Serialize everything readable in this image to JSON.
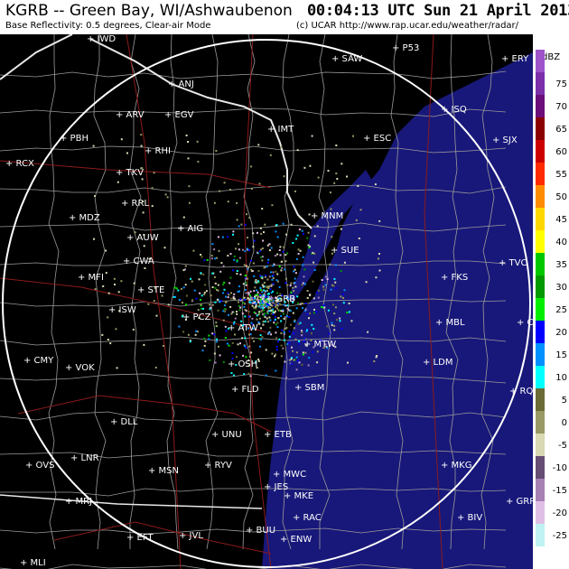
{
  "header": {
    "station": "KGRB -- Green Bay, WI/Ashwaubenon",
    "datetime": "00:04:13 UTC Sun 21 April 2013",
    "product": "Base Reflectivity: 0.5 degrees, Clear-air Mode",
    "credit": "(c) UCAR  http://www.rap.ucar.edu/weather/radar/"
  },
  "legend": {
    "title": "dBZ",
    "levels": [
      {
        "label": "75",
        "color": "#9e53c9"
      },
      {
        "label": "70",
        "color": "#7b2fa8"
      },
      {
        "label": "65",
        "color": "#6b0e7a"
      },
      {
        "label": "60",
        "color": "#8b0000"
      },
      {
        "label": "55",
        "color": "#cd0000"
      },
      {
        "label": "50",
        "color": "#ff2a00"
      },
      {
        "label": "45",
        "color": "#ff8c00"
      },
      {
        "label": "40",
        "color": "#ffd700"
      },
      {
        "label": "35",
        "color": "#ffff00"
      },
      {
        "label": "30",
        "color": "#00c800"
      },
      {
        "label": "25",
        "color": "#009900"
      },
      {
        "label": "20",
        "color": "#00ee00"
      },
      {
        "label": "15",
        "color": "#0000ff"
      },
      {
        "label": "10",
        "color": "#0090ff"
      },
      {
        "label": "5",
        "color": "#00ffff"
      },
      {
        "label": "0",
        "color": "#6b6b36"
      },
      {
        "label": "-5",
        "color": "#999966"
      },
      {
        "label": "-10",
        "color": "#d9d9b3"
      },
      {
        "label": "-15",
        "color": "#664d73"
      },
      {
        "label": "-20",
        "color": "#a680b3"
      },
      {
        "label": "-25",
        "color": "#e0bfe6"
      },
      {
        "label": "",
        "color": "#bff2f2"
      }
    ]
  },
  "map": {
    "lake_color": "#18187a",
    "county_color": "#9a9a9a",
    "state_color": "#e8e8e8",
    "highway_color": "#8b1a1a",
    "range_ring_color": "#ffffff"
  },
  "cities": [
    {
      "name": "IWD"
    },
    {
      "name": "SAW"
    },
    {
      "name": "P53"
    },
    {
      "name": "ERY"
    },
    {
      "name": "ANJ"
    },
    {
      "name": "ISQ"
    },
    {
      "name": "SJX"
    },
    {
      "name": "ARV"
    },
    {
      "name": "EGV"
    },
    {
      "name": "IMT"
    },
    {
      "name": "PBH"
    },
    {
      "name": "RHI"
    },
    {
      "name": "ESC"
    },
    {
      "name": "RCX"
    },
    {
      "name": "TKV"
    },
    {
      "name": "RRL"
    },
    {
      "name": "MNM"
    },
    {
      "name": "MDZ"
    },
    {
      "name": "AIG"
    },
    {
      "name": "AUW"
    },
    {
      "name": "SUE"
    },
    {
      "name": "CWA"
    },
    {
      "name": "TVC"
    },
    {
      "name": "MFI"
    },
    {
      "name": "STE"
    },
    {
      "name": "FKS"
    },
    {
      "name": "GRB"
    },
    {
      "name": "ISW"
    },
    {
      "name": "PCZ"
    },
    {
      "name": "ATW"
    },
    {
      "name": "MBL"
    },
    {
      "name": "CAD"
    },
    {
      "name": "MTW"
    },
    {
      "name": "CMY"
    },
    {
      "name": "OSH"
    },
    {
      "name": "VOK"
    },
    {
      "name": "LDM"
    },
    {
      "name": "FLD"
    },
    {
      "name": "SBM"
    },
    {
      "name": "RQB"
    },
    {
      "name": "DLL"
    },
    {
      "name": "UNU"
    },
    {
      "name": "ETB"
    },
    {
      "name": "LNR"
    },
    {
      "name": "OVS"
    },
    {
      "name": "MSN"
    },
    {
      "name": "RYV"
    },
    {
      "name": "MWC"
    },
    {
      "name": "MKG"
    },
    {
      "name": "JES"
    },
    {
      "name": "MKE"
    },
    {
      "name": "GRR"
    },
    {
      "name": "MRJ"
    },
    {
      "name": "RAC"
    },
    {
      "name": "BIV"
    },
    {
      "name": "EFT"
    },
    {
      "name": "JVL"
    },
    {
      "name": "BUU"
    },
    {
      "name": "ENW"
    },
    {
      "name": "MLI"
    }
  ]
}
